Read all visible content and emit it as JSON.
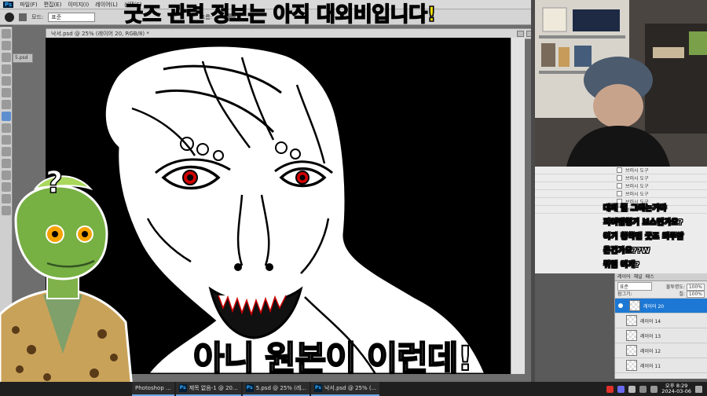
{
  "headline": "굿즈 관련 정보는 아직 대외비입니다!",
  "subtitle": "아니 원본이 이런데!",
  "menu": {
    "app": "Ps",
    "items": [
      "파일(F)",
      "편집(E)",
      "이미지(I)",
      "레이어(L)",
      "선택(S)"
    ]
  },
  "options": {
    "mode_label": "모드:",
    "mode_value": "표준",
    "flow_label": "흐름:"
  },
  "document": {
    "tab_title": "낙서.psd @ 25% (레이어 20, RGB/8) *",
    "small_tab": "5.psd"
  },
  "history": {
    "items": [
      "브러시 도구",
      "브러시 도구",
      "브러시 도구",
      "브러시 도구",
      "브러시 도구",
      "브러시 도구"
    ]
  },
  "layers": {
    "tabs": [
      "레이어",
      "채널",
      "패스"
    ],
    "blend_mode": "표준",
    "opacity_label": "불투명도:",
    "opacity_value": "100%",
    "lock_label": "잠그기:",
    "fill_label": "칠:",
    "fill_value": "100%",
    "items": [
      {
        "name": "레이어 20",
        "active": true
      },
      {
        "name": "레이어 14",
        "active": false
      },
      {
        "name": "레이어 13",
        "active": false
      },
      {
        "name": "레이어 12",
        "active": false
      },
      {
        "name": "레이어 11",
        "active": false
      }
    ]
  },
  "chat": {
    "lines": [
      "대체 뭘 그리는거야",
      "피어앤헝거 보스인가요?",
      "이거 칭착맨 굿즈 외주받",
      "은건가요??W",
      "뭐임 이게?"
    ]
  },
  "sticker": {
    "mark": "?"
  },
  "taskbar": {
    "items": [
      {
        "label": "Photoshop ..."
      },
      {
        "label": "제목 없음-1 @ 20..."
      },
      {
        "label": "5.psd @ 25% (레..."
      },
      {
        "label": "낙서.psd @ 25% (..."
      }
    ],
    "time": "오후 8:29",
    "date": "2024-03-06"
  },
  "colors": {
    "headline": "#ffe500",
    "layer_active": "#1c78d4",
    "eye_red": "#d10000"
  }
}
